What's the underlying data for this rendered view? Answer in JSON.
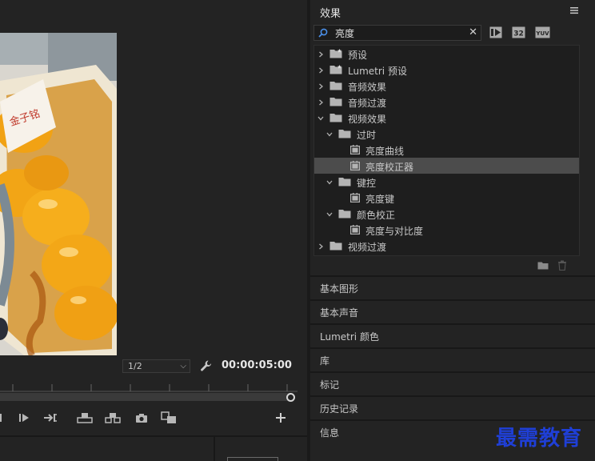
{
  "monitor": {
    "scale_value": "1/2",
    "timecode": "00:00:05:00",
    "video_sign_text": "金子铭"
  },
  "effects": {
    "title": "效果",
    "search": {
      "value": "亮度"
    },
    "filter_labels": {
      "accelerated": "",
      "bit32": "32",
      "yuv": "YUV"
    },
    "tree": [
      {
        "label": "预设",
        "level": 0,
        "kind": "bin-star",
        "expanded": false
      },
      {
        "label": "Lumetri 预设",
        "level": 0,
        "kind": "bin-star",
        "expanded": false
      },
      {
        "label": "音频效果",
        "level": 0,
        "kind": "bin",
        "expanded": false
      },
      {
        "label": "音频过渡",
        "level": 0,
        "kind": "bin",
        "expanded": false
      },
      {
        "label": "视频效果",
        "level": 0,
        "kind": "bin",
        "expanded": true
      },
      {
        "label": "过时",
        "level": 1,
        "kind": "bin",
        "expanded": true
      },
      {
        "label": "亮度曲线",
        "level": 2,
        "kind": "effect"
      },
      {
        "label": "亮度校正器",
        "level": 2,
        "kind": "effect",
        "selected": true
      },
      {
        "label": "键控",
        "level": 1,
        "kind": "bin",
        "expanded": true
      },
      {
        "label": "亮度键",
        "level": 2,
        "kind": "effect"
      },
      {
        "label": "颜色校正",
        "level": 1,
        "kind": "bin",
        "expanded": true
      },
      {
        "label": "亮度与对比度",
        "level": 2,
        "kind": "effect"
      },
      {
        "label": "视频过渡",
        "level": 0,
        "kind": "bin",
        "expanded": false
      }
    ]
  },
  "panels": [
    "基本图形",
    "基本声音",
    "Lumetri 颜色",
    "库",
    "标记",
    "历史记录",
    "信息"
  ],
  "watermark": "最需教育",
  "colors": {
    "selected_row": "#4c4c4c",
    "watermark": "#1f3fd6",
    "panel_bg": "#232323"
  }
}
